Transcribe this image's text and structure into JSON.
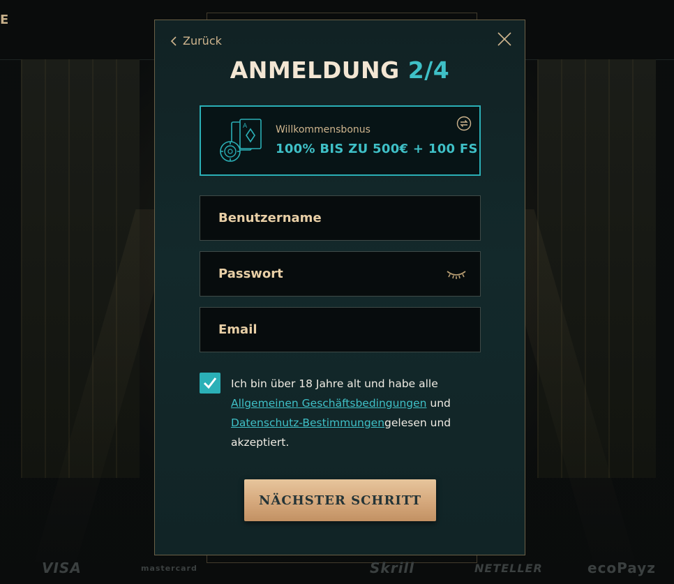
{
  "background": {
    "topbar_stub": "E",
    "footer_logos": [
      "VISA",
      "mastercard",
      "Skrill",
      "NETELLER",
      "ecoPayz"
    ]
  },
  "modal": {
    "back_label": "Zurück",
    "title_main": "ANMELDUNG",
    "title_step": "2/4",
    "bonus": {
      "label": "Willkommensbonus",
      "value": "100% BIS ZU 500€ + 100 FS"
    },
    "fields": {
      "username_placeholder": "Benutzername",
      "password_placeholder": "Passwort",
      "email_placeholder": "Email"
    },
    "terms": {
      "checked": true,
      "text_1": "Ich bin über 18 Jahre alt und habe alle ",
      "link_1": "Allgemeinen Geschäftsbedingungen",
      "text_2": " und ",
      "link_2": "Datenschutz-Bestimmungen",
      "text_3": "gelesen und akzeptiert."
    },
    "next_button": "NÄCHSTER SCHRITT"
  },
  "colors": {
    "accent_teal": "#3fc0c7",
    "gold": "#cfb58e",
    "button_gold": "#d5a87c"
  }
}
